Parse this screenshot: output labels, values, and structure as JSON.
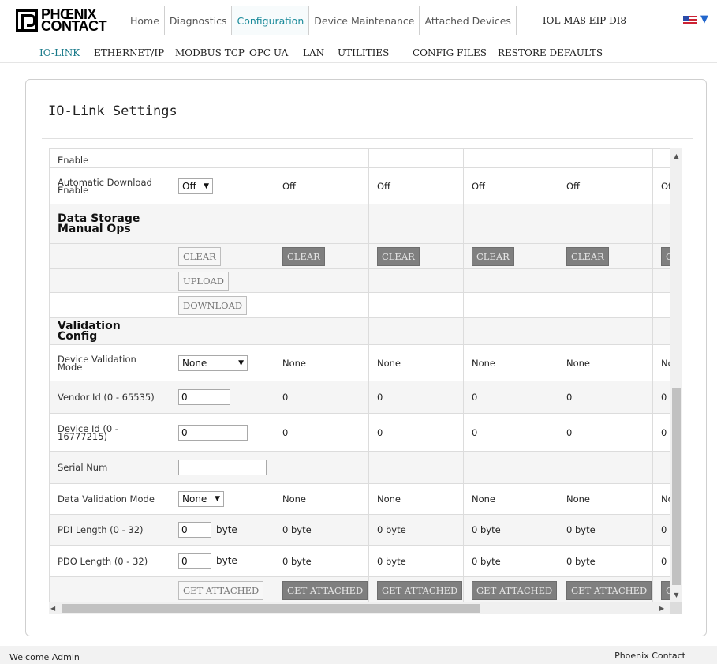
{
  "brand": {
    "line1": "PHŒNIX",
    "line2": "CONTACT"
  },
  "nav": {
    "tabs": [
      "Home",
      "Diagnostics",
      "Configuration",
      "Device Maintenance",
      "Attached Devices"
    ],
    "active": "Configuration",
    "device_name": "IOL MA8 EIP DI8",
    "language_icon": "us-flag-icon"
  },
  "subnav": {
    "items": [
      "IO-LINK",
      "ETHERNET/IP",
      "MODBUS TCP",
      "OPC UA",
      "LAN",
      "UTILITIES",
      "CONFIG FILES",
      "RESTORE DEFAULTS"
    ],
    "active": "IO-LINK"
  },
  "panel": {
    "title": "IO-Link Settings"
  },
  "table": {
    "rows": {
      "enable_partial": "Enable",
      "auto_download": {
        "label": "Automatic Download Enable",
        "select": "Off",
        "values": [
          "Off",
          "Off",
          "Off",
          "Off",
          "Of"
        ]
      },
      "ds_manual_ops": {
        "label": "Data Storage Manual Ops"
      },
      "clear": {
        "label": "CLEAR",
        "partial": "C"
      },
      "upload": "UPLOAD",
      "download": "DOWNLOAD",
      "validation_config": "Validation Config",
      "device_validation": {
        "label": "Device Validation Mode",
        "select": "None",
        "values": [
          "None",
          "None",
          "None",
          "None",
          "No"
        ]
      },
      "vendor_id": {
        "label": "Vendor Id (0 - 65535)",
        "input": "0",
        "values": [
          "0",
          "0",
          "0",
          "0",
          "0"
        ]
      },
      "device_id": {
        "label": "Device Id (0 - 16777215)",
        "input": "0",
        "values": [
          "0",
          "0",
          "0",
          "0",
          "0"
        ]
      },
      "serial_num": {
        "label": "Serial Num",
        "input": ""
      },
      "data_validation": {
        "label": "Data Validation Mode",
        "select": "None",
        "values": [
          "None",
          "None",
          "None",
          "None",
          "No"
        ]
      },
      "pdi_length": {
        "label": "PDI Length (0 - 32)",
        "input": "0",
        "unit": "byte",
        "values": [
          "0 byte",
          "0 byte",
          "0 byte",
          "0 byte",
          "0"
        ]
      },
      "pdo_length": {
        "label": "PDO Length (0 - 32)",
        "input": "0",
        "unit": "byte",
        "values": [
          "0 byte",
          "0 byte",
          "0 byte",
          "0 byte",
          "0"
        ]
      },
      "get_attached": {
        "label": "GET ATTACHED",
        "partial": "G"
      }
    }
  },
  "footer": {
    "welcome": "Welcome Admin",
    "company": "Phoenix Contact"
  }
}
